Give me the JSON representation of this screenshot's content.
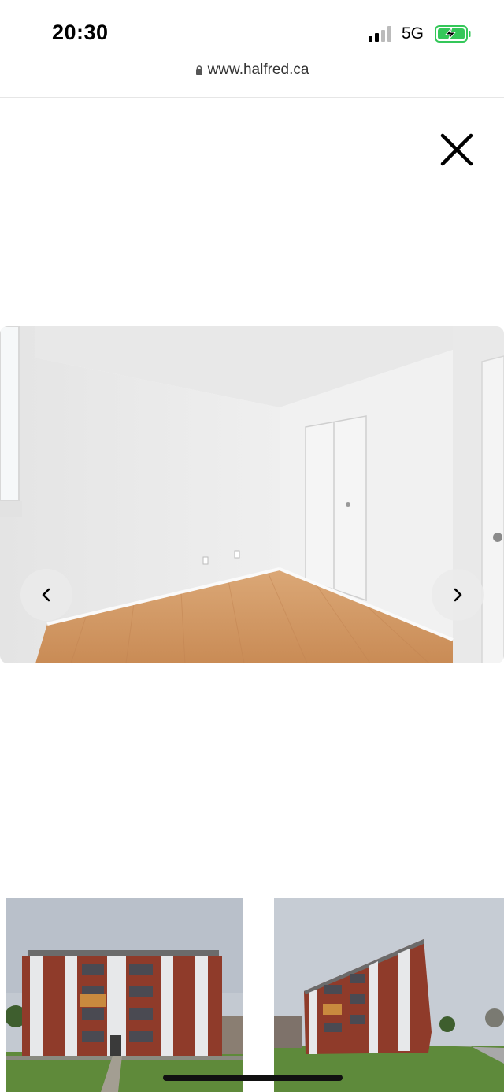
{
  "status_bar": {
    "time": "20:30",
    "network": "5G",
    "signal_icon": "signal-bars-icon",
    "battery_icon": "battery-charging-icon",
    "battery_color": "#34c759"
  },
  "browser": {
    "url": "www.halfred.ca",
    "lock_icon": "lock-icon"
  },
  "gallery": {
    "close_icon": "close-icon",
    "prev_icon": "chevron-left-icon",
    "next_icon": "chevron-right-icon",
    "main_photo": "empty bedroom photo",
    "thumbnails": [
      {
        "icon": "apartment-building-photo"
      },
      {
        "icon": "apartment-building-photo"
      }
    ]
  }
}
